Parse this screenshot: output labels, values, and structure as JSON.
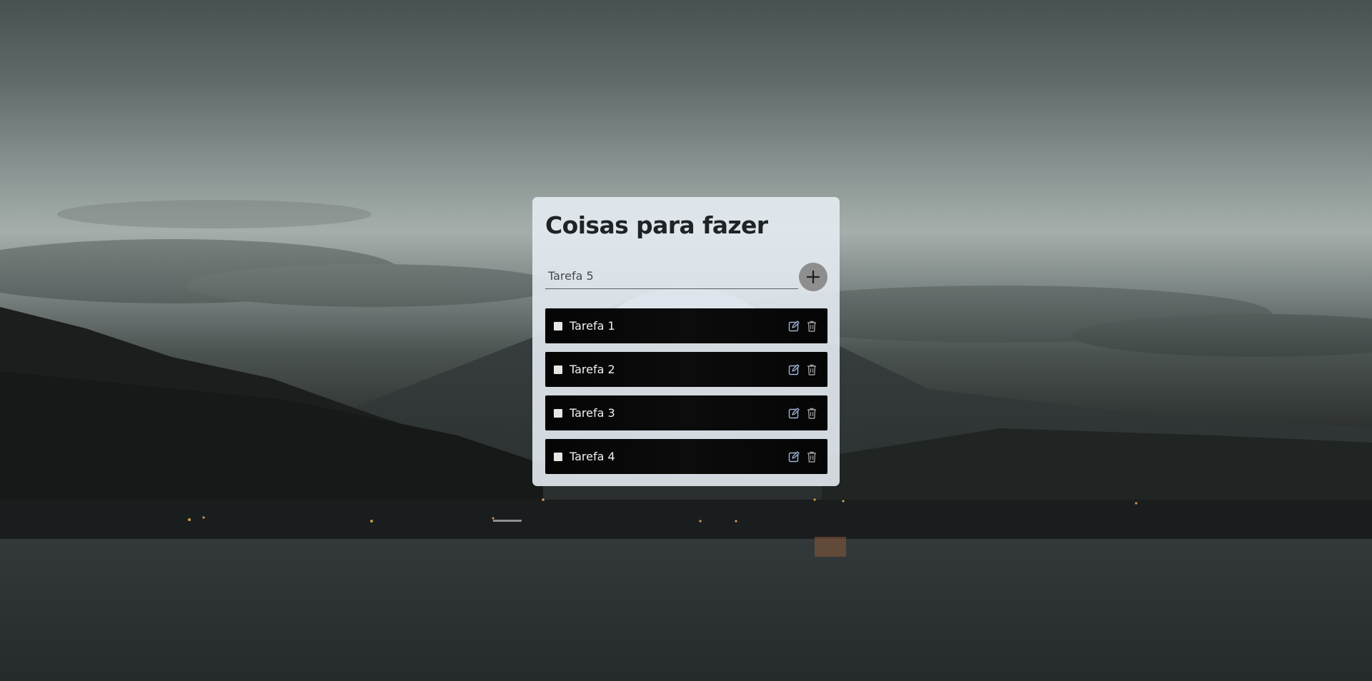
{
  "app": {
    "title": "Coisas para fazer"
  },
  "new_task": {
    "value": "Tarefa 5",
    "add_icon": "plus-icon"
  },
  "tasks": [
    {
      "label": "Tarefa 1",
      "checked": false
    },
    {
      "label": "Tarefa 2",
      "checked": false
    },
    {
      "label": "Tarefa 3",
      "checked": false
    },
    {
      "label": "Tarefa 4",
      "checked": false
    }
  ],
  "icons": {
    "edit": "edit-icon",
    "delete": "trash-icon"
  },
  "colors": {
    "card_background": "#e4ebf2",
    "task_background": "#050505",
    "add_button": "#8e8e8e",
    "edit_icon": "#9fb4d6",
    "delete_icon": "#9a9a9a"
  }
}
